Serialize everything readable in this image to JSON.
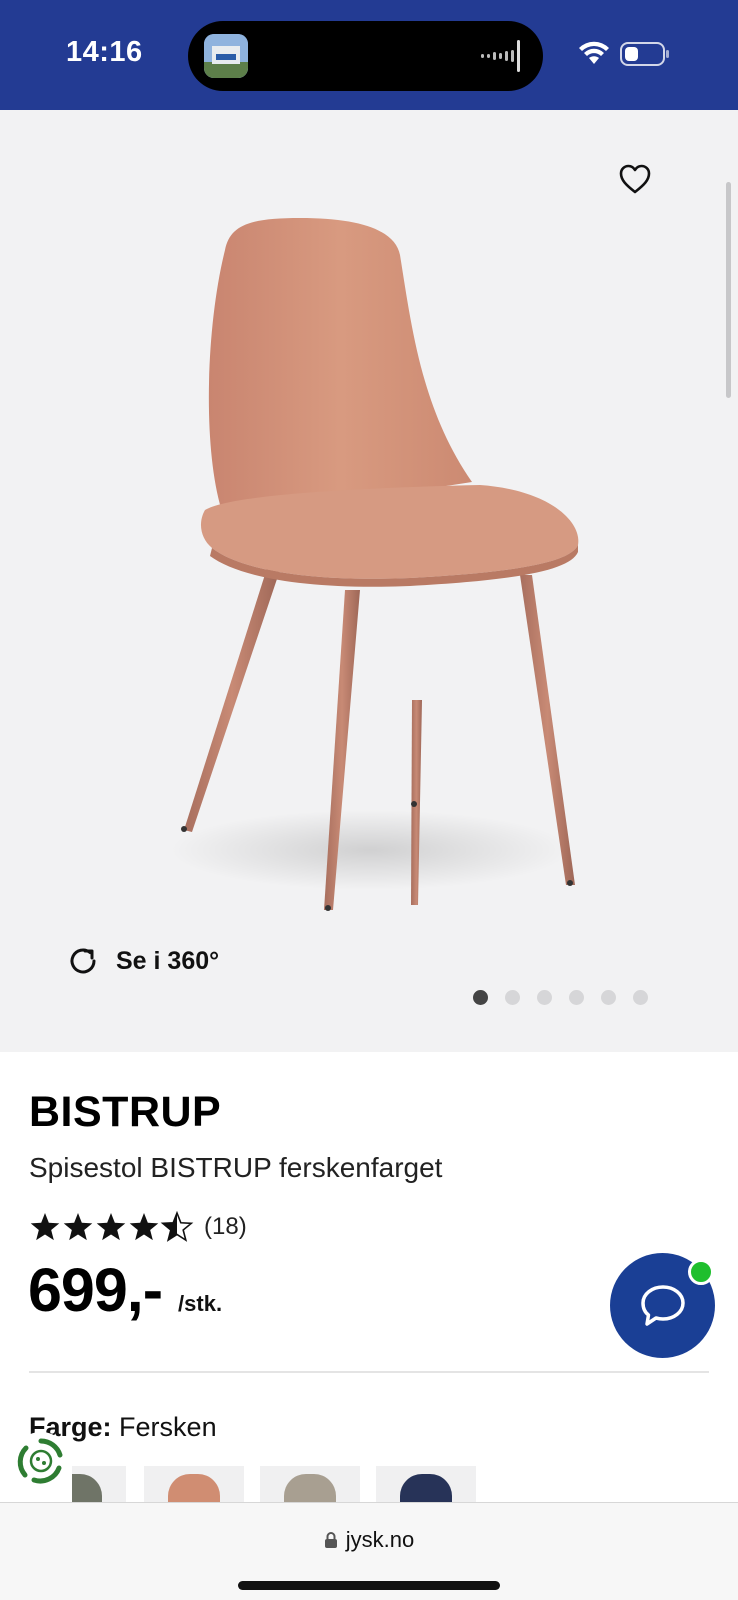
{
  "status_bar": {
    "time": "14:16"
  },
  "gallery": {
    "spin_label": "Se i 360°",
    "slide_count": 6,
    "active_slide": 1
  },
  "product": {
    "brand": "BISTRUP",
    "name": "Spisestol BISTRUP ferskenfarget",
    "rating": 4.5,
    "rating_max": 5,
    "review_count": "(18)",
    "price": "699,-",
    "unit": "/stk."
  },
  "color_selector": {
    "label": "Farge:",
    "value": "Fersken",
    "swatches": [
      {
        "color": "#6f7467"
      },
      {
        "color": "#d08d72"
      },
      {
        "color": "#a89f91"
      },
      {
        "color": "#273358"
      }
    ]
  },
  "browser": {
    "url": "jysk.no"
  },
  "colors": {
    "header_blue": "#233b93",
    "chat_blue": "#1a3f95",
    "online_green": "#1fbf2e",
    "chair_peach": "#cf8c73"
  }
}
